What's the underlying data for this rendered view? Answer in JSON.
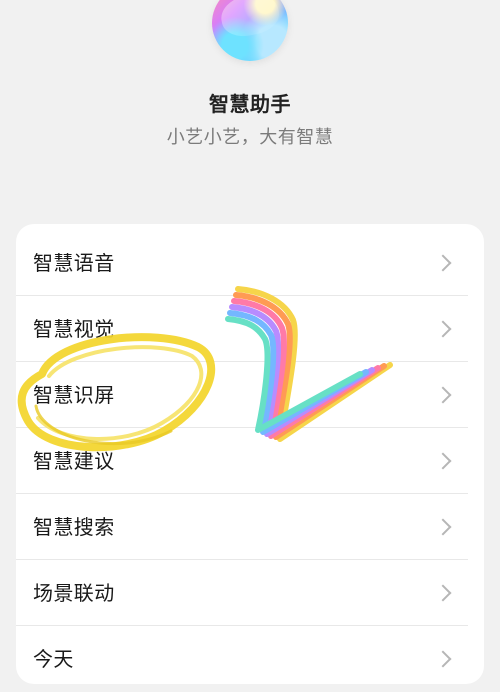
{
  "header": {
    "title": "智慧助手",
    "subtitle": "小艺小艺，大有智慧",
    "logo_icon": "assistant-orb-icon"
  },
  "menu": {
    "items": [
      {
        "label": "智慧语音",
        "icon": "chevron-right-icon"
      },
      {
        "label": "智慧视觉",
        "icon": "chevron-right-icon"
      },
      {
        "label": "智慧识屏",
        "icon": "chevron-right-icon"
      },
      {
        "label": "智慧建议",
        "icon": "chevron-right-icon"
      },
      {
        "label": "智慧搜索",
        "icon": "chevron-right-icon"
      },
      {
        "label": "场景联动",
        "icon": "chevron-right-icon"
      },
      {
        "label": "今天",
        "icon": "chevron-right-icon"
      }
    ]
  },
  "annotations": {
    "highlight_circle_color": "#f2d72a",
    "rainbow_mark_colors": [
      "#f6d54a",
      "#ff9b54",
      "#ff7aa7",
      "#b78cff",
      "#74b7ff",
      "#67e0c5"
    ]
  }
}
